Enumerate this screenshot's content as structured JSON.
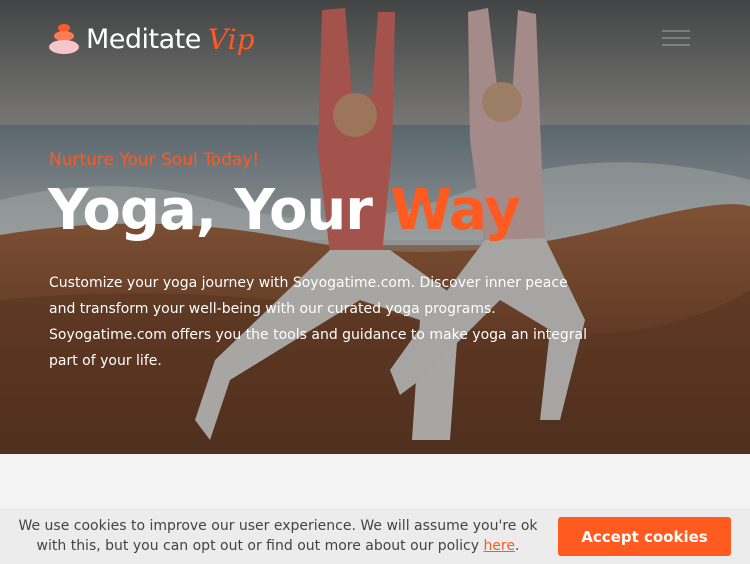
{
  "brand": {
    "name": "Meditate",
    "suffix": "Vip"
  },
  "hero": {
    "eyebrow": "Nurture Your Soul Today!",
    "headline_main": "Yoga, Your ",
    "headline_accent": "Way",
    "description": "Customize your yoga journey with Soyogatime.com. Discover inner peace and transform your well-being with our curated yoga programs. Soyogatime.com offers you the tools and guidance to make yoga an integral part of your life."
  },
  "cookie": {
    "text_before": "We use cookies to improve our user experience. We will assume you're ok with this, but you can opt out or find out more about our policy ",
    "link": "here",
    "text_after": ".",
    "accept_label": "Accept cookies"
  },
  "colors": {
    "accent": "#ff5a1f",
    "cookie_bg": "#ececec"
  },
  "icons": {
    "menu": "hamburger-icon",
    "logo": "stacked-stones-icon"
  }
}
